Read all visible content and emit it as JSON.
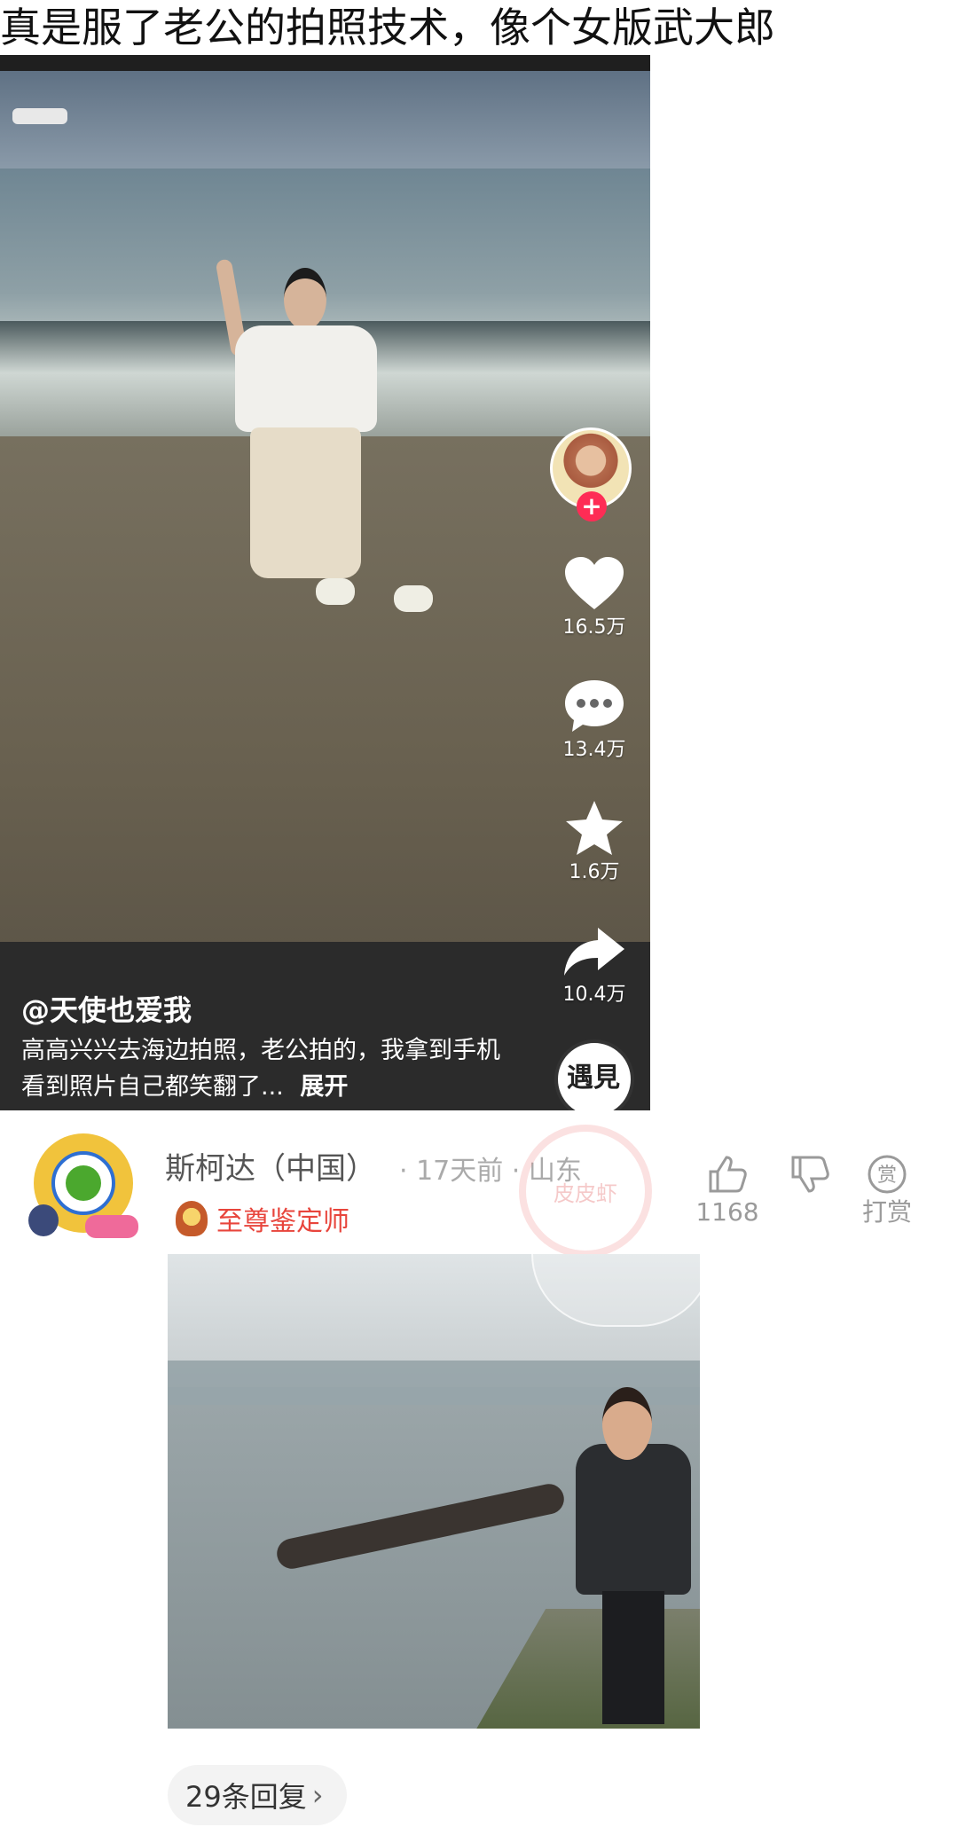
{
  "post": {
    "title": "真是服了老公的拍照技术，像个女版武大郎"
  },
  "video": {
    "author": "@天使也爱我",
    "caption": "高高兴兴去海边拍照，老公拍的，我拿到手机看到照片自己都笑翻了...",
    "expand_label": "展开",
    "follow_label": "+",
    "actions": {
      "like_count": "16.5万",
      "comment_count": "13.4万",
      "favorite_count": "1.6万",
      "share_count": "10.4万"
    },
    "music_seal_text": "遇見"
  },
  "comment": {
    "user_name": "斯柯达（中国）",
    "meta": "· 17天前 · 山东",
    "badge_label": "至尊鉴定师",
    "like_count": "1168",
    "reward_label": "打赏",
    "reward_icon_text": "赏",
    "watermark_text": "皮皮虾",
    "replies_label": "29条回复",
    "replies_chevron": "›"
  },
  "colors": {
    "badge_red": "#e8453c",
    "follow_pink": "#fe2c55",
    "muted_gray": "#9a9a9a"
  }
}
